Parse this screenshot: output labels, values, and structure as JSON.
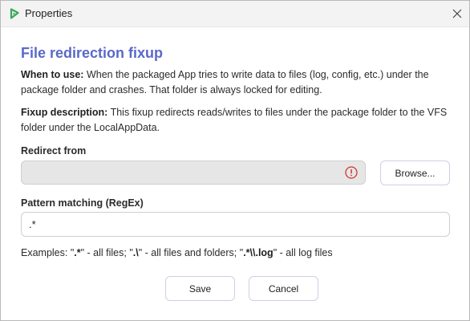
{
  "window": {
    "title": "Properties",
    "icons": {
      "app": "app-logo-icon",
      "close": "close-icon"
    }
  },
  "content": {
    "heading": "File redirection fixup",
    "when_to_use": {
      "label": "When to use:",
      "text": " When the packaged App tries to write data to files (log, config, etc.) under the package folder and crashes. That folder is always locked for editing."
    },
    "fixup_description": {
      "label": "Fixup description:",
      "text": " This fixup redirects reads/writes to files under the package folder to the VFS folder under the LocalAppData."
    }
  },
  "redirect_from": {
    "label": "Redirect from",
    "value": "",
    "status_icon": "error-icon",
    "status_color": "#d13438",
    "browse_label": "Browse..."
  },
  "pattern": {
    "label": "Pattern matching (RegEx)",
    "value": ".*"
  },
  "examples": {
    "prefix": "Examples: \"",
    "ex1": ".*",
    "sep1": "\" - all files; \"",
    "ex2": ".\\",
    "sep2": "\" - all files and folders; \"",
    "ex3": ".*\\\\.log",
    "sep3": "\" - all log files"
  },
  "buttons": {
    "save": "Save",
    "cancel": "Cancel"
  },
  "colors": {
    "heading": "#5a68c9",
    "app_icon": "#3aa657",
    "button_border": "#cfcfe8",
    "disabled_input": "#e6e6e6"
  }
}
